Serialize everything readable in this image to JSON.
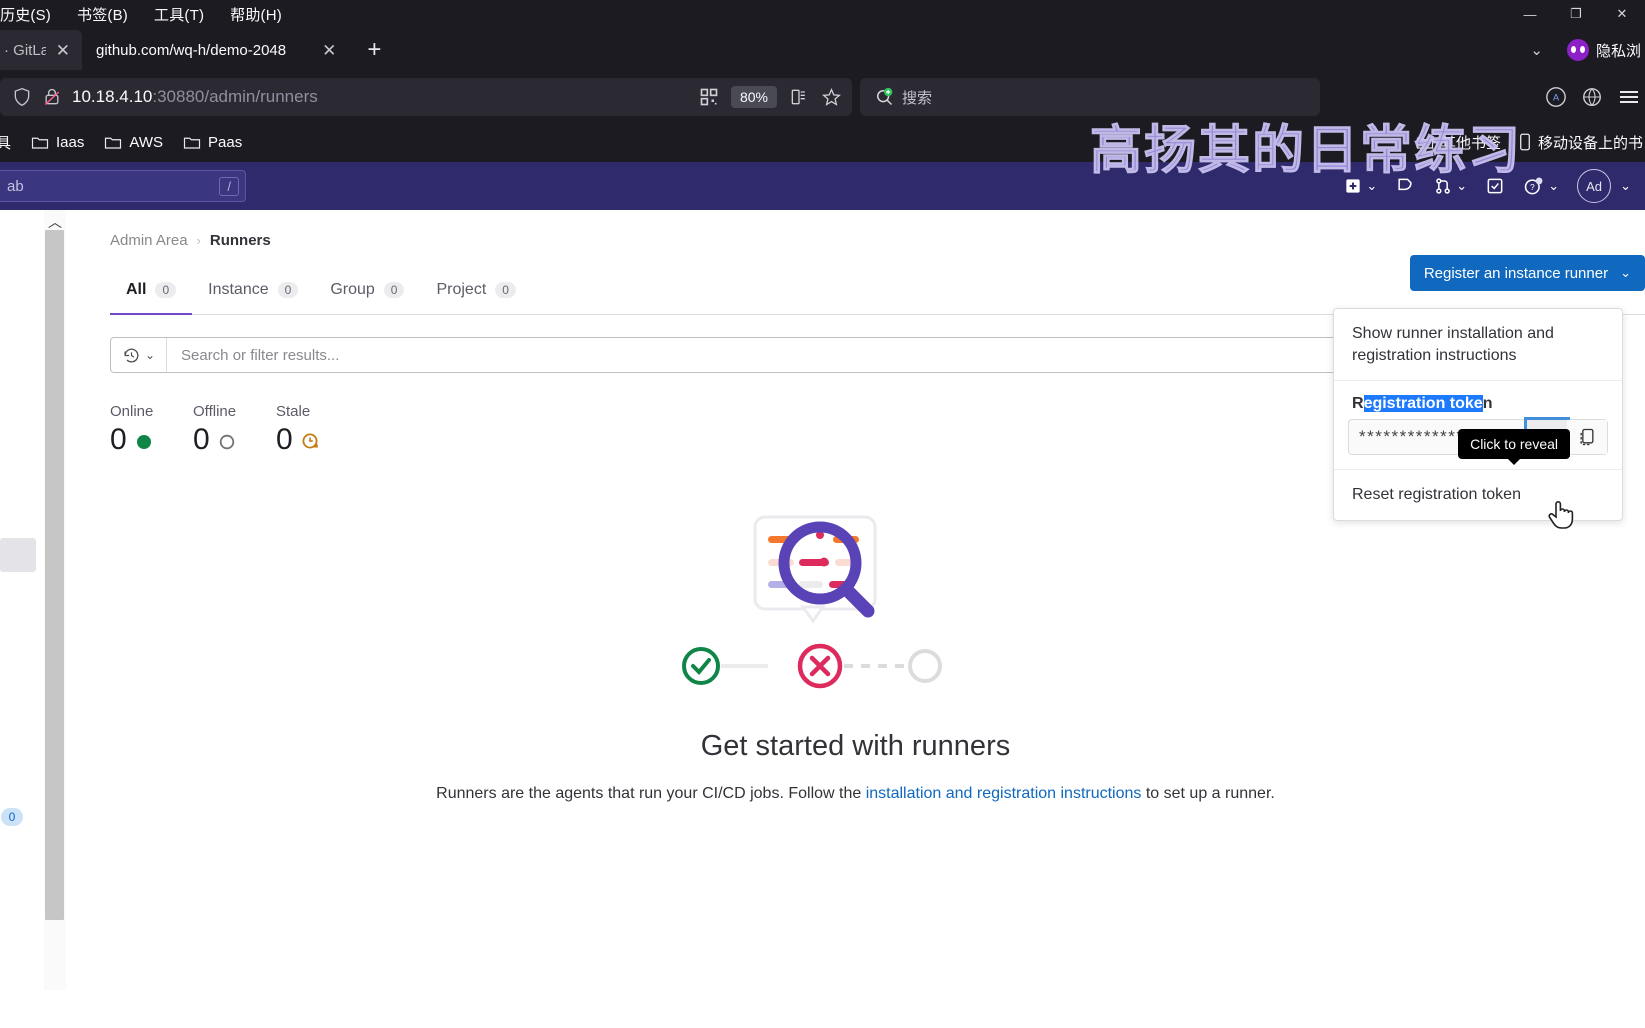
{
  "browser": {
    "menu": [
      {
        "label": "历史(S)"
      },
      {
        "label": "书签(B)"
      },
      {
        "label": "工具(T)"
      },
      {
        "label": "帮助(H)"
      }
    ],
    "window_controls": {
      "minimize": "—",
      "restore": "❐",
      "close": "✕"
    },
    "tabs": [
      {
        "title": "· GitLab",
        "active": false,
        "close": "✕"
      },
      {
        "title": "github.com/wq-h/demo-2048",
        "active": true,
        "close": "✕"
      }
    ],
    "new_tab_label": "+",
    "tab_list_chevron": "⌄",
    "private_browsing_label": "隐私浏",
    "url": {
      "host": "10.18.4.10",
      "path": ":30880/admin/runners",
      "zoom_level": "80%",
      "shield_icon": "shield-icon",
      "lock_broken_icon": "lock-broken-icon",
      "qr_icon": "qr-code-icon",
      "reader_icon": "reader-view-icon",
      "bookmark_icon": "star-icon"
    },
    "search": {
      "placeholder": "搜索",
      "icon": "search-icon"
    },
    "bookmarks": [
      {
        "label": "具",
        "icon": "none"
      },
      {
        "label": "Iaas",
        "icon": "folder-icon"
      },
      {
        "label": "AWS",
        "icon": "folder-icon"
      },
      {
        "label": "Paas",
        "icon": "folder-icon"
      }
    ],
    "bookmarks_right": [
      {
        "label": "其他书签",
        "icon": "folder-icon"
      },
      {
        "label": "移动设备上的书",
        "icon": "mobile-icon"
      }
    ],
    "menu_icon": "hamburger-menu-icon",
    "watermark": "高扬其的日常练习"
  },
  "gitlab_nav": {
    "search_placeholder": "ab",
    "slash_key": "/",
    "icons": [
      {
        "name": "new-dropdown",
        "glyph": "plus-square-icon",
        "chevron": "⌄"
      },
      {
        "name": "issues",
        "glyph": "issues-icon",
        "chevron": ""
      },
      {
        "name": "merge-requests",
        "glyph": "merge-request-icon",
        "chevron": "⌄"
      },
      {
        "name": "todos",
        "glyph": "todo-check-icon",
        "chevron": ""
      },
      {
        "name": "help",
        "glyph": "question-circle-icon",
        "chevron": "⌄"
      }
    ],
    "avatar_initials": "Ad",
    "avatar_chevron": "⌄"
  },
  "page": {
    "breadcrumb": {
      "root": "Admin Area",
      "separator": "›",
      "current": "Runners"
    },
    "tabs": [
      {
        "label": "All",
        "count": "0",
        "active": true
      },
      {
        "label": "Instance",
        "count": "0",
        "active": false
      },
      {
        "label": "Group",
        "count": "0",
        "active": false
      },
      {
        "label": "Project",
        "count": "0",
        "active": false
      }
    ],
    "register_button": {
      "label": "Register an instance runner",
      "chevron": "⌄",
      "color": "#1068bf"
    },
    "filter": {
      "placeholder": "Search or filter results...",
      "history_icon": "history-icon",
      "chevron": "⌄"
    },
    "stats": [
      {
        "label": "Online",
        "value": "0",
        "icon": "status-online-dot",
        "color": "#108548"
      },
      {
        "label": "Offline",
        "value": "0",
        "icon": "status-offline-circle",
        "color": "#737278"
      },
      {
        "label": "Stale",
        "value": "0",
        "icon": "status-stale-clock",
        "color": "#c17d10"
      }
    ],
    "empty_state": {
      "heading": "Get started with runners",
      "text_before": "Runners are the agents that run your CI/CD jobs. Follow the ",
      "link": "installation and registration instructions",
      "text_after": " to set up a runner.",
      "illustration": "runners-empty-state-illustration"
    },
    "sidebar_badge": "0"
  },
  "dropdown": {
    "instructions_item": "Show runner installation and registration instructions",
    "token_label_prefix": "R",
    "token_label_selected": "egistration toke",
    "token_label_suffix": "n",
    "token_value": "*******************",
    "reveal_icon": "eye-icon",
    "copy_icon": "copy-clipboard-icon",
    "tooltip": "Click to reveal",
    "reset_item": "Reset registration token"
  }
}
